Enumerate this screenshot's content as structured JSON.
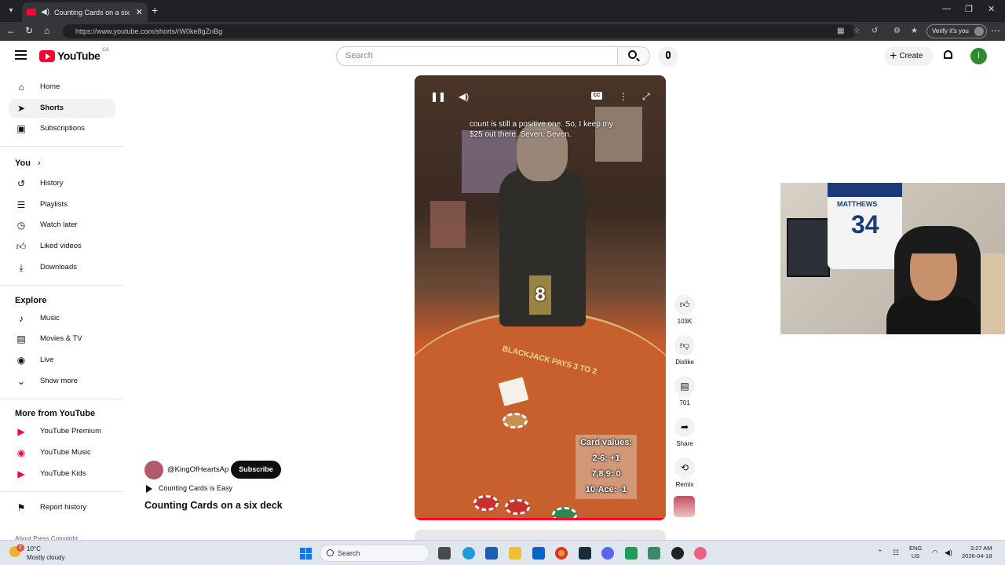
{
  "browser": {
    "tab_title": "Counting Cards on a six deck",
    "url": "https://www.youtube.com/shorts/rW0ke8gZnBg",
    "verify_label": "Verify it's you"
  },
  "header": {
    "logo_text": "YouTube",
    "country": "CA",
    "search_placeholder": "Search",
    "create_label": "Create",
    "avatar_letter": "I"
  },
  "sidebar": {
    "main": [
      {
        "label": "Home",
        "icon": "home-icon"
      },
      {
        "label": "Shorts",
        "icon": "shorts-icon"
      },
      {
        "label": "Subscriptions",
        "icon": "subscriptions-icon"
      }
    ],
    "you_heading": "You",
    "you": [
      {
        "label": "History",
        "icon": "history-icon"
      },
      {
        "label": "Playlists",
        "icon": "playlists-icon"
      },
      {
        "label": "Watch later",
        "icon": "watch-later-icon"
      },
      {
        "label": "Liked videos",
        "icon": "thumbs-up-icon"
      },
      {
        "label": "Downloads",
        "icon": "download-icon"
      }
    ],
    "explore_heading": "Explore",
    "explore": [
      {
        "label": "Music",
        "icon": "music-icon"
      },
      {
        "label": "Movies & TV",
        "icon": "movies-icon"
      },
      {
        "label": "Live",
        "icon": "live-icon"
      },
      {
        "label": "Show more",
        "icon": "chevron-down-icon"
      }
    ],
    "more_heading": "More from YouTube",
    "more": [
      {
        "label": "YouTube Premium",
        "icon": "youtube-premium-icon"
      },
      {
        "label": "YouTube Music",
        "icon": "youtube-music-icon"
      },
      {
        "label": "YouTube Kids",
        "icon": "youtube-kids-icon"
      }
    ],
    "report_history": "Report history",
    "footer": "About Press Copyright"
  },
  "video": {
    "caption": "count is still a positive one. So, I keep my $25 out there. Seven. Seven.",
    "count_overlay": "8",
    "table_text": "BLACKJACK PAYS 3 TO 2",
    "card_values": [
      "Card values:",
      "2-6: +1",
      "7,8,9: 0",
      "10-Ace: -1"
    ]
  },
  "actions": {
    "like_count": "103K",
    "dislike_label": "Dislike",
    "comments_count": "701",
    "share_label": "Share",
    "remix_label": "Remix"
  },
  "meta": {
    "channel": "@KingOfHeartsAp",
    "subscribe_label": "Subscribe",
    "playlist": "Counting Cards is Easy",
    "title": "Counting Cards on a six deck"
  },
  "webcam": {
    "jersey_name": "MATTHEWS",
    "jersey_number": "34"
  },
  "taskbar": {
    "temperature": "10°C",
    "weather": "Mostly cloudy",
    "weather_badge": "2",
    "search_label": "Search",
    "lang_line1": "ENG",
    "lang_line2": "US",
    "time": "3:27 AM",
    "date": "2026-04-18"
  }
}
